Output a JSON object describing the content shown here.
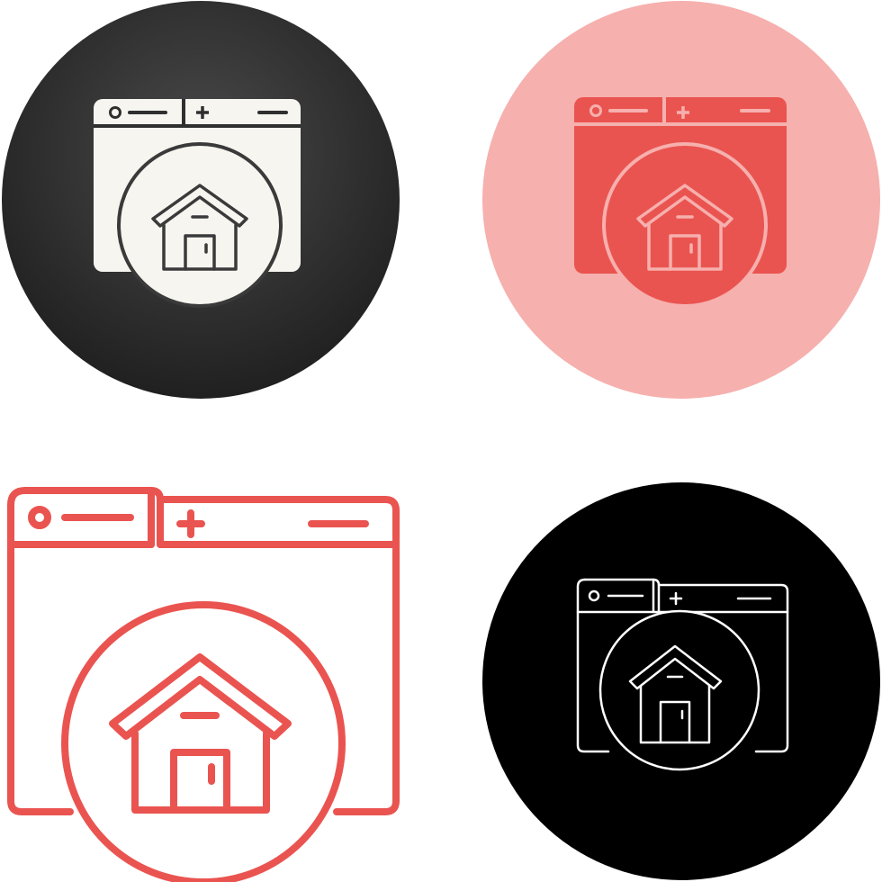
{
  "icon_set": {
    "subject": "browser-home-icon",
    "variants": [
      {
        "style": "glyph-on-dark-circle",
        "background": "#2b2b2b",
        "fill": "#f7f5f0",
        "stroke": "#3a3a3a"
      },
      {
        "style": "flat-on-pink-circle",
        "background": "#f6b0ae",
        "fill": "#ea5450",
        "stroke": "#f6b0ae"
      },
      {
        "style": "outline-red",
        "background": "#ffffff",
        "fill": "#ffffff",
        "stroke": "#ea5450"
      },
      {
        "style": "outline-on-black-circle",
        "background": "#000000",
        "fill": "#000000",
        "stroke": "#ffffff"
      }
    ]
  }
}
